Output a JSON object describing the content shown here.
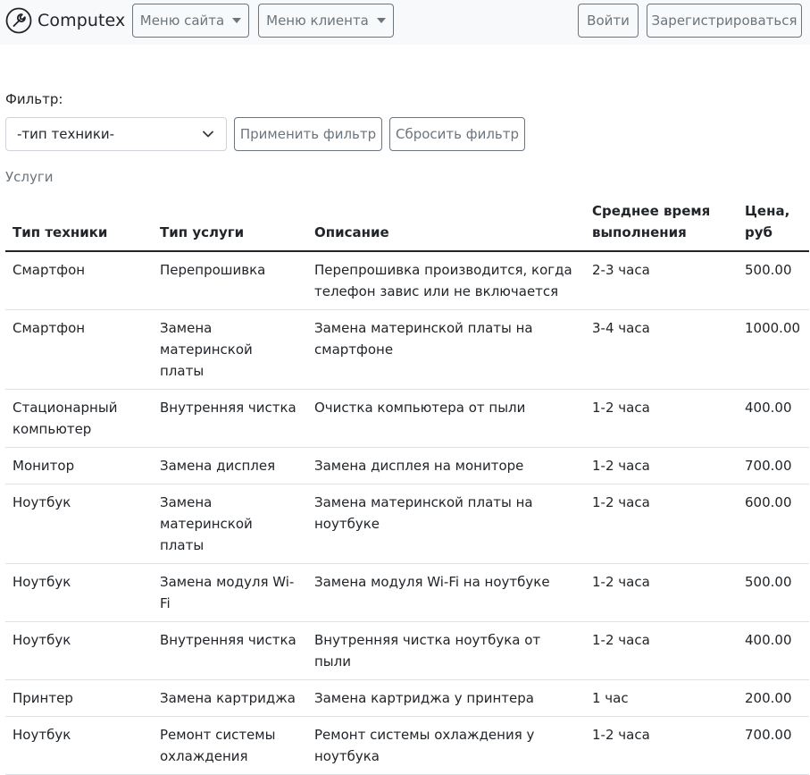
{
  "navbar": {
    "brand": "Computex",
    "site_menu": "Меню сайта",
    "client_menu": "Меню клиента",
    "login": "Войти",
    "register": "Зарегистрироваться"
  },
  "filter": {
    "label": "Фильтр:",
    "select_value": "-тип техники-",
    "apply": "Применить фильтр",
    "reset": "Сбросить фильтр"
  },
  "section_caption": "Услуги",
  "table": {
    "headers": [
      "Тип техники",
      "Тип услуги",
      "Описание",
      "Среднее время выполнения",
      "Цена, руб"
    ],
    "rows": [
      [
        "Смартфон",
        "Перепрошивка",
        "Перепрошивка производится, когда телефон завис или не включается",
        "2-3 часа",
        "500.00"
      ],
      [
        "Смартфон",
        "Замена материнской платы",
        "Замена материнской платы на смартфоне",
        "3-4 часа",
        "1000.00"
      ],
      [
        "Стационарный компьютер",
        "Внутренняя чистка",
        "Очистка компьютера от пыли",
        "1-2 часа",
        "400.00"
      ],
      [
        "Монитор",
        "Замена дисплея",
        "Замена дисплея на мониторе",
        "1-2 часа",
        "700.00"
      ],
      [
        "Ноутбук",
        "Замена материнской платы",
        "Замена материнской платы на ноутбуке",
        "1-2 часа",
        "600.00"
      ],
      [
        "Ноутбук",
        "Замена модуля Wi-Fi",
        "Замена модуля Wi-Fi на ноутбуке",
        "1-2 часа",
        "500.00"
      ],
      [
        "Ноутбук",
        "Внутренняя чистка",
        "Внутренняя чистка ноутбука от пыли",
        "1-2 часа",
        "400.00"
      ],
      [
        "Принтер",
        "Замена картриджа",
        "Замена картриджа у принтера",
        "1 час",
        "200.00"
      ],
      [
        "Ноутбук",
        "Ремонт системы охлаждения",
        "Ремонт системы охлаждения у ноутбука",
        "1-2 часа",
        "700.00"
      ]
    ]
  },
  "icons": {
    "brand": "wrench-icon",
    "dropdown": "caret-down-icon",
    "select": "chevron-down-icon"
  }
}
